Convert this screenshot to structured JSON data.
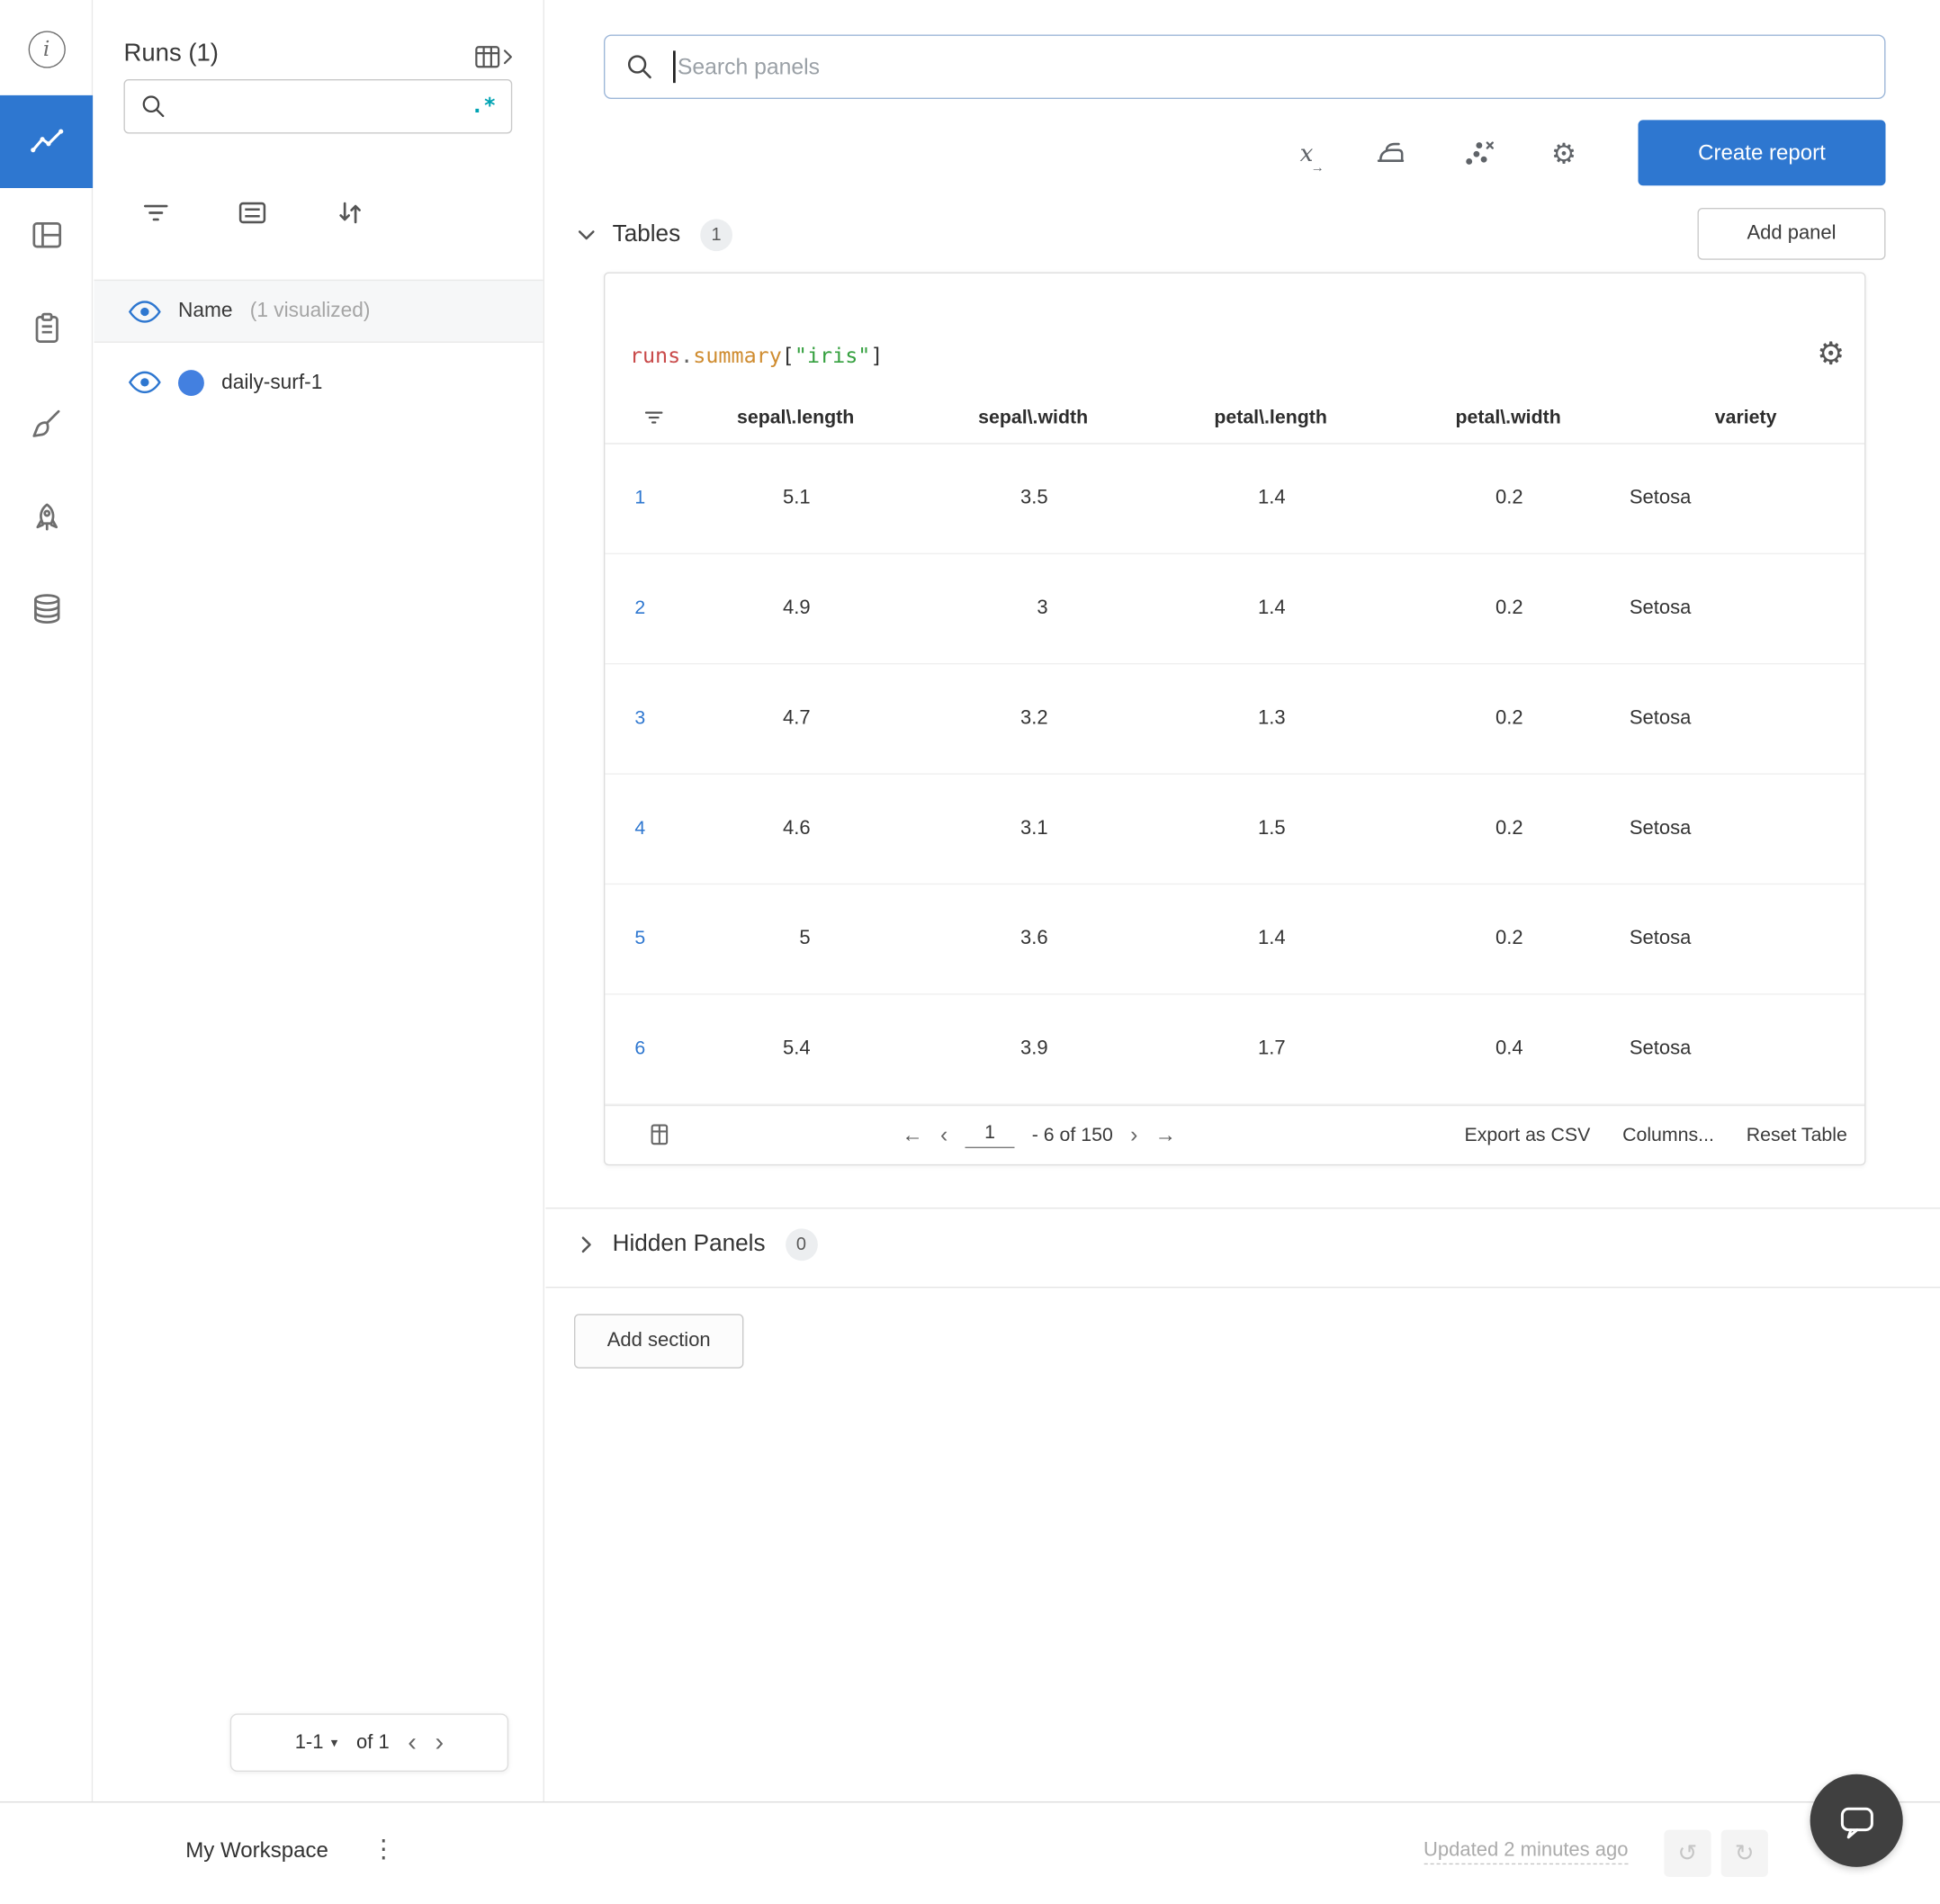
{
  "colors": {
    "accent": "#2e77d0",
    "run_dot": "#4380e0",
    "regex_teal": "#00a3b3",
    "code_red": "#c94a4a",
    "code_orange": "#cf8c30",
    "code_green": "#35a03f",
    "badge_bg": "#eceef0"
  },
  "icon_rail": {
    "items": [
      {
        "name": "info",
        "selected": false
      },
      {
        "name": "workspace-chart",
        "selected": true
      },
      {
        "name": "panels",
        "selected": false
      },
      {
        "name": "logs",
        "selected": false
      },
      {
        "name": "sweeps",
        "selected": false
      },
      {
        "name": "launch",
        "selected": false
      },
      {
        "name": "artifacts",
        "selected": false
      }
    ]
  },
  "runs_sidebar": {
    "title": "Runs (1)",
    "regex_badge": ".*",
    "visualized_row": {
      "label": "Name",
      "suffix": "(1 visualized)"
    },
    "runs": [
      {
        "name": "daily-surf-1"
      }
    ],
    "pagination": {
      "range": "1-1",
      "of_label": "of 1"
    }
  },
  "main": {
    "search_placeholder": "Search panels",
    "create_report_label": "Create report",
    "tables_section": {
      "label": "Tables",
      "count": "1",
      "add_panel_label": "Add panel"
    },
    "hidden_section": {
      "label": "Hidden Panels",
      "count": "0"
    },
    "add_section_label": "Add section"
  },
  "panel": {
    "code": {
      "obj": "runs",
      "dot": ".",
      "prop": "summary",
      "open": "[",
      "str": "\"iris\"",
      "close": "]"
    },
    "table": {
      "headers": [
        "sepal\\.length",
        "sepal\\.width",
        "petal\\.length",
        "petal\\.width",
        "variety"
      ],
      "rows": [
        {
          "idx": "1",
          "values": [
            "5.1",
            "3.5",
            "1.4",
            "0.2",
            "Setosa"
          ]
        },
        {
          "idx": "2",
          "values": [
            "4.9",
            "3",
            "1.4",
            "0.2",
            "Setosa"
          ]
        },
        {
          "idx": "3",
          "values": [
            "4.7",
            "3.2",
            "1.3",
            "0.2",
            "Setosa"
          ]
        },
        {
          "idx": "4",
          "values": [
            "4.6",
            "3.1",
            "1.5",
            "0.2",
            "Setosa"
          ]
        },
        {
          "idx": "5",
          "values": [
            "5",
            "3.6",
            "1.4",
            "0.2",
            "Setosa"
          ]
        },
        {
          "idx": "6",
          "values": [
            "5.4",
            "3.9",
            "1.7",
            "0.4",
            "Setosa"
          ]
        }
      ],
      "footer": {
        "page_value": "1",
        "range_label": "- 6 of 150",
        "export_label": "Export as CSV",
        "columns_label": "Columns...",
        "reset_label": "Reset Table"
      }
    }
  },
  "bottom_bar": {
    "workspace_label": "My Workspace",
    "updated_label": "Updated 2 minutes ago"
  }
}
